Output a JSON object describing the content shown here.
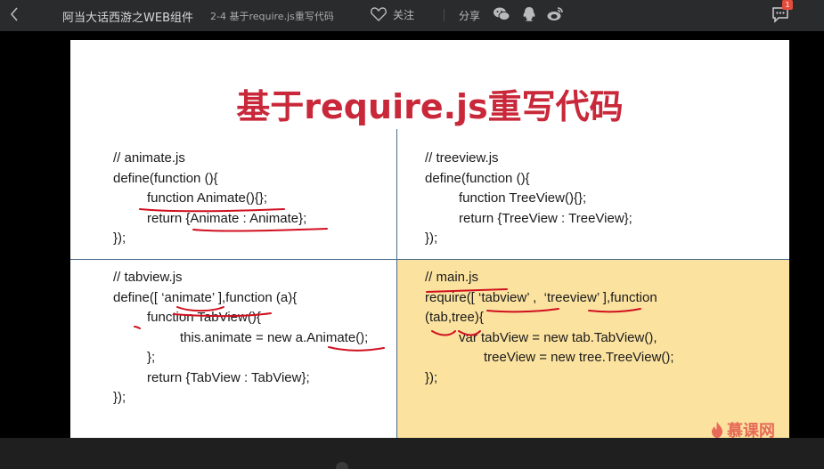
{
  "topbar": {
    "course_title": "阿当大话西游之WEB组件",
    "lesson_title": "2-4 基于require.js重写代码",
    "follow_label": "关注",
    "share_label": "分享",
    "message_badge": "1"
  },
  "slide": {
    "title": "基于require.js重写代码",
    "animate": [
      "// animate.js",
      "define(function (){",
      "function Animate(){};",
      "return {Animate : Animate};",
      "});"
    ],
    "treeview": [
      "// treeview.js",
      "define(function (){",
      "function TreeView(){};",
      "return {TreeView : TreeView};",
      "});"
    ],
    "tabview": [
      "// tabview.js",
      "define([ ‘animate’ ],function (a){",
      "function TabView(){",
      "this.animate = new a.Animate();",
      "};",
      "return {TabView : TabView};",
      "});"
    ],
    "main": [
      "// main.js",
      "require([ ‘tabview’ ,  ‘treeview’ ],function",
      "(tab,tree){",
      "var tabView = new tab.TabView(),",
      "treeView = new tree.TreeView();",
      "});"
    ],
    "logo_text": "慕课网"
  },
  "colors": {
    "title": "#c9283a",
    "highlight": "#fbe29f",
    "annotation": "#d01020"
  }
}
